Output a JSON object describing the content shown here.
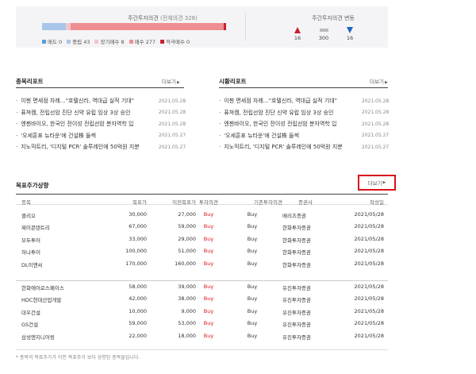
{
  "colors": {
    "sell": "#5b9bd5",
    "hold": "#a9c6ea",
    "long_buy": "#f3c6c9",
    "buy": "#ee8e92",
    "strong_buy": "#c8202f",
    "up": "#c8202f",
    "down": "#1f66c2"
  },
  "opinion": {
    "title": "주간투자의견",
    "total_label": "(전체의견 328)",
    "bar": [
      {
        "key": "sell",
        "count": 0
      },
      {
        "key": "hold",
        "count": 43
      },
      {
        "key": "long_buy",
        "count": 8
      },
      {
        "key": "buy",
        "count": 277
      },
      {
        "key": "strong_buy",
        "count": 0
      }
    ],
    "legend": [
      {
        "label": "매도 0",
        "color": "#5b9bd5"
      },
      {
        "label": "중립 43",
        "color": "#a9c6ea"
      },
      {
        "label": "장기매수 8",
        "color": "#f3c6c9"
      },
      {
        "label": "매수 277",
        "color": "#ee8e92"
      },
      {
        "label": "적극매수 0",
        "color": "#c8202f"
      }
    ]
  },
  "change": {
    "title": "주간투자의견 변동",
    "up": {
      "icon": "up-triangle-icon",
      "value": "16"
    },
    "same": {
      "icon": "dash-icon",
      "value": "300"
    },
    "down": {
      "icon": "down-triangle-icon",
      "value": "16"
    }
  },
  "stock_reports": {
    "title": "종목리포트",
    "more": "더보기",
    "items": [
      {
        "title": "이젠 면세점 차례…\"호텔신라, 역대급 실적 기대\"",
        "date": "2021.05.28"
      },
      {
        "title": "퓨쳐켐, 전립선암 진단 신약 유럽 임상 3상 승인",
        "date": "2021.05.28"
      },
      {
        "title": "엔젠바이오, 한국인 전이성 전립선암 분자역학 입",
        "date": "2021.05.28"
      },
      {
        "title": "'오세훈표 뉴타운'에 건설株 들썩",
        "date": "2021.05.27"
      },
      {
        "title": "지노믹트리, '디지털 PCR' 솔루레인에 50억원 지분",
        "date": "2021.05.27"
      }
    ]
  },
  "market_reports": {
    "title": "시황리포트",
    "more": "더보기",
    "items": [
      {
        "title": "이젠 면세점 차례…\"호텔신라, 역대급 실적 기대\"",
        "date": "2021.05.28"
      },
      {
        "title": "퓨쳐켐, 전립선암 진단 신약 유럽 임상 3상 승인",
        "date": "2021.05.28"
      },
      {
        "title": "엔젠바이오, 한국인 전이성 전립선암 분자역학 입",
        "date": "2021.05.28"
      },
      {
        "title": "'오세훈표 뉴타운'에 건설株 들썩",
        "date": "2021.05.27"
      },
      {
        "title": "지노믹트리, '디지털 PCR' 솔루레인에 50억원 지분",
        "date": "2021.05.27"
      }
    ]
  },
  "target_up": {
    "title": "목표주가상향",
    "more": "더보기",
    "headers": {
      "name": "종목",
      "target": "목표가",
      "prev_target": "이전목표가",
      "opinion": "투자의견",
      "prev_opinion": "기존투자의견",
      "firm": "증권사",
      "date": "작성일"
    },
    "groups": [
      [
        {
          "name": "클리오",
          "target": "30,000",
          "prev_target": "27,000",
          "opinion": "Buy",
          "prev_opinion": "Buy",
          "firm": "메리츠증권",
          "date": "2021/05/28"
        },
        {
          "name": "제이콘텐트리",
          "target": "67,000",
          "prev_target": "59,000",
          "opinion": "Buy",
          "prev_opinion": "Buy",
          "firm": "한화투자증권",
          "date": "2021/05/28"
        },
        {
          "name": "모두투어",
          "target": "33,000",
          "prev_target": "29,000",
          "opinion": "Buy",
          "prev_opinion": "Buy",
          "firm": "한화투자증권",
          "date": "2021/05/28"
        },
        {
          "name": "하나투어",
          "target": "100,000",
          "prev_target": "51,000",
          "opinion": "Buy",
          "prev_opinion": "Buy",
          "firm": "한화투자증권",
          "date": "2021/05/28"
        },
        {
          "name": "DL이앤씨",
          "target": "170,000",
          "prev_target": "160,000",
          "opinion": "Buy",
          "prev_opinion": "Buy",
          "firm": "한화투자증권",
          "date": "2021/05/28"
        }
      ],
      [
        {
          "name": "한화에어로스페이스",
          "target": "58,000",
          "prev_target": "39,000",
          "opinion": "Buy",
          "prev_opinion": "Buy",
          "firm": "유진투자증권",
          "date": "2021/05/28"
        },
        {
          "name": "HDC현대산업개발",
          "target": "42,000",
          "prev_target": "38,000",
          "opinion": "Buy",
          "prev_opinion": "Buy",
          "firm": "유진투자증권",
          "date": "2021/05/28"
        },
        {
          "name": "대우건설",
          "target": "10,000",
          "prev_target": "9,000",
          "opinion": "Buy",
          "prev_opinion": "Buy",
          "firm": "유진투자증권",
          "date": "2021/05/28"
        },
        {
          "name": "GS건설",
          "target": "59,000",
          "prev_target": "53,000",
          "opinion": "Buy",
          "prev_opinion": "Buy",
          "firm": "유진투자증권",
          "date": "2021/05/28"
        },
        {
          "name": "삼성엔지니어링",
          "target": "22,000",
          "prev_target": "18,000",
          "opinion": "Buy",
          "prev_opinion": "Buy",
          "firm": "유진투자증권",
          "date": "2021/05/28"
        }
      ]
    ],
    "footnote": "* 종목의 목표주가가 이전 목표주가 보다 상향된 종목들입니다."
  }
}
